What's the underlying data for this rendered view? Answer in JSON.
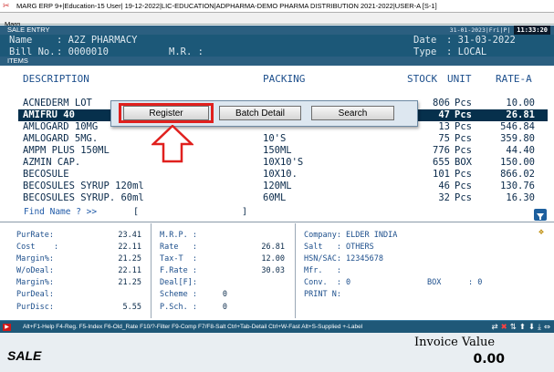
{
  "window": {
    "title": "MARG ERP 9+|Education-15 User| 19-12-2022|LIC-EDUCATION|ADPHARMA-DEMO PHARMA DISTRIBUTION 2021-2022|USER-A [S-1]"
  },
  "menubar": {
    "item": "Marg"
  },
  "sale_entry": {
    "panel_title": "SALE ENTRY",
    "status_date": "31-01-2023|Fri|P|",
    "status_time": "11:33:20",
    "name_label": "Name",
    "name_value": ": A2Z PHARMACY",
    "bill_label": "Bill No.",
    "bill_value": ": 0000010",
    "mr_label": "M.R. :",
    "date_label": "Date",
    "date_value": ": 31-03-2022",
    "type_label": "Type",
    "type_value": ": LOCAL"
  },
  "items": {
    "panel_title": "ITEMS",
    "columns": {
      "description": "DESCRIPTION",
      "packing": "PACKING",
      "stock": "STOCK",
      "unit": "UNIT",
      "rate": "RATE-A"
    },
    "rows": [
      {
        "description": "ACNEDERM LOT",
        "packing": "",
        "stock": "806",
        "unit": "Pcs",
        "rate": "10.00"
      },
      {
        "description": "AMIFRU 40",
        "packing": "",
        "stock": "47",
        "unit": "Pcs",
        "rate": "26.81"
      },
      {
        "description": "AMLOGARD 10MG",
        "packing": "",
        "stock": "13",
        "unit": "Pcs",
        "rate": "546.84"
      },
      {
        "description": "AMLOGARD 5MG.",
        "packing": "10'S",
        "stock": "75",
        "unit": "Pcs",
        "rate": "359.80"
      },
      {
        "description": "AMPM PLUS 150ML",
        "packing": "150ML",
        "stock": "776",
        "unit": "Pcs",
        "rate": "44.40"
      },
      {
        "description": "AZMIN CAP.",
        "packing": "10X10'S",
        "stock": "655",
        "unit": "BOX",
        "rate": "150.00"
      },
      {
        "description": "BECOSULE",
        "packing": "10X10.",
        "stock": "101",
        "unit": "Pcs",
        "rate": "866.02"
      },
      {
        "description": "BECOSULES SYRUP 120ml",
        "packing": "120ML",
        "stock": "46",
        "unit": "Pcs",
        "rate": "130.76"
      },
      {
        "description": "BECOSULES SYRUP. 60ml",
        "packing": "60ML",
        "stock": "32",
        "unit": "Pcs",
        "rate": "16.30"
      }
    ],
    "selected_index": 1,
    "find_label": "Find Name ? >>"
  },
  "popup": {
    "register": "Register",
    "batch_detail": "Batch Detail",
    "search": "Search"
  },
  "details": {
    "col1": [
      {
        "label": "PurRate:",
        "value": "23.41"
      },
      {
        "label": "Cost    :",
        "value": "22.11"
      },
      {
        "label": "Margin%:",
        "value": "21.25"
      },
      {
        "label": "W/oDeal:",
        "value": "22.11"
      },
      {
        "label": "Margin%:",
        "value": "21.25"
      },
      {
        "label": "PurDeal:",
        "value": ""
      },
      {
        "label": "PurDisc:",
        "value": "5.55"
      }
    ],
    "col2": [
      {
        "label": "M.R.P. :",
        "value": ""
      },
      {
        "label": "Rate   :",
        "value": "26.81"
      },
      {
        "label": "Tax-T  :",
        "value": "12.00"
      },
      {
        "label": "F.Rate :",
        "value": "30.03"
      },
      {
        "label": "Deal[F]:",
        "value": ""
      },
      {
        "label": "Scheme :",
        "value": "0"
      },
      {
        "label": "P.Sch. :",
        "value": "0"
      }
    ],
    "col3": [
      "Company: ELDER INDIA",
      "Salt   : OTHERS",
      "HSN/SAC: 12345678",
      "Mfr.   :",
      "Conv.  : 0",
      "PRINT N:"
    ],
    "box_label": "BOX",
    "box_value": ": 0"
  },
  "keybar": {
    "shortcuts": "Alt+F1-Help F4-Reg. F5-Index F6-Old_Rate F10/?-Filter F9-Comp F7/F8-Salt Ctrl+Tab-Detail Ctrl+W-Fast Alt+S-Supplied +-Label"
  },
  "footer": {
    "mode": "SALE",
    "invoice_label": "Invoice Value",
    "invoice_value": "0.00"
  },
  "colors": {
    "header_bg": "#1c5878",
    "selected_row_bg": "#06304c",
    "highlight_red": "#e0201e"
  }
}
